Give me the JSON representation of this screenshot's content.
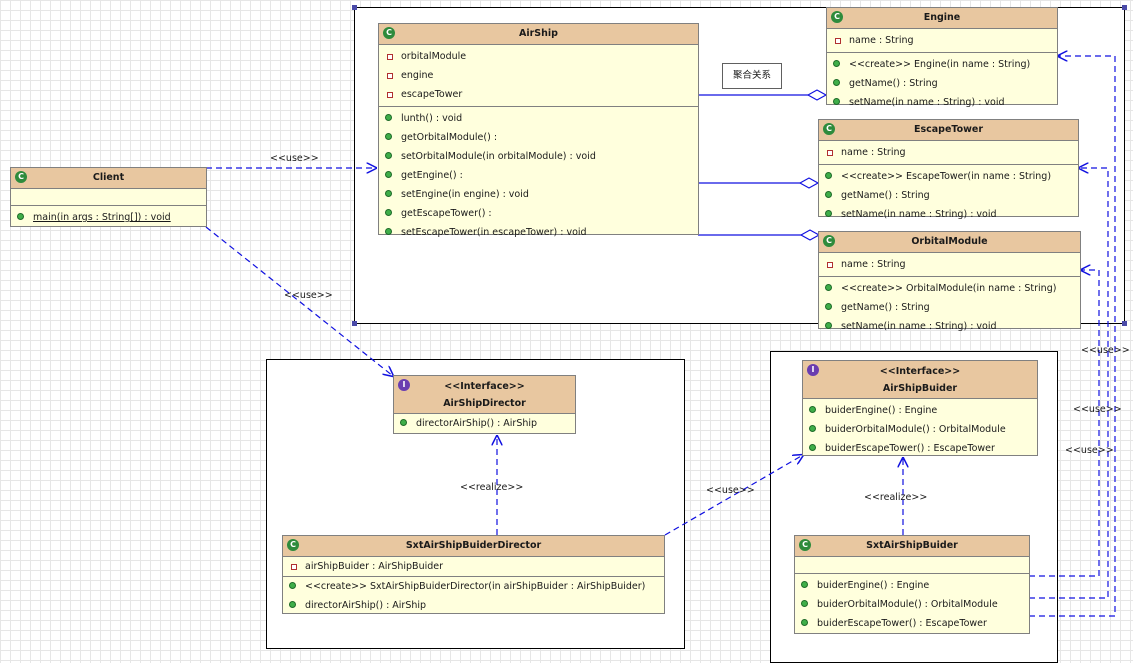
{
  "labels": {
    "use_client_airship": "<<use>>",
    "use_client_director": "<<use>>",
    "realize_director": "<<realize>>",
    "realize_builder": "<<realize>>",
    "use_director_builder": "<<use>>",
    "use_right_1": "<<use>>",
    "use_right_2": "<<use>>",
    "use_right_3": "<<use>>"
  },
  "note": {
    "text": "聚合关系"
  },
  "classes": {
    "client": {
      "name": "Client",
      "operations": [
        "main(in args : String[]) : void"
      ]
    },
    "airship": {
      "name": "AirShip",
      "attributes": [
        "orbitalModule",
        "engine",
        "escapeTower"
      ],
      "operations": [
        "lunth() : void",
        "getOrbitalModule() :",
        "setOrbitalModule(in orbitalModule) : void",
        "getEngine() :",
        "setEngine(in engine) : void",
        "getEscapeTower() :",
        "setEscapeTower(in escapeTower) : void"
      ]
    },
    "engine": {
      "name": "Engine",
      "attributes": [
        "name : String"
      ],
      "operations": [
        "<<create>> Engine(in name : String)",
        "getName() : String",
        "setName(in name : String) : void"
      ]
    },
    "escape_tower": {
      "name": "EscapeTower",
      "attributes": [
        "name : String"
      ],
      "operations": [
        "<<create>> EscapeTower(in name : String)",
        "getName() : String",
        "setName(in name : String) : void"
      ]
    },
    "orbital_module": {
      "name": "OrbitalModule",
      "attributes": [
        "name : String"
      ],
      "operations": [
        "<<create>> OrbitalModule(in name : String)",
        "getName() : String",
        "setName(in name : String) : void"
      ]
    },
    "airship_director": {
      "stereotype": "<<Interface>>",
      "name": "AirShipDirector",
      "operations": [
        "directorAirShip() : AirShip"
      ]
    },
    "airship_builder": {
      "stereotype": "<<Interface>>",
      "name": "AirShipBuider",
      "operations": [
        "buiderEngine() : Engine",
        "buiderOrbitalModule() : OrbitalModule",
        "buiderEscapeTower() : EscapeTower"
      ]
    },
    "sxt_director": {
      "name": "SxtAirShipBuiderDirector",
      "attributes": [
        "airShipBuider : AirShipBuider"
      ],
      "operations": [
        "<<create>> SxtAirShipBuiderDirector(in airShipBuider : AirShipBuider)",
        "directorAirShip() : AirShip"
      ]
    },
    "sxt_builder": {
      "name": "SxtAirShipBuider",
      "operations": [
        "buiderEngine() : Engine",
        "buiderOrbitalModule() : OrbitalModule",
        "buiderEscapeTower() : EscapeTower"
      ]
    }
  },
  "colors": {
    "class_fill": "#ffffdd",
    "class_header": "#e8c7a0",
    "link": "#1010e0",
    "class_icon": "#2e8b3c",
    "interface_icon": "#6a3db0"
  },
  "icons": {
    "class": "class-icon",
    "interface": "interface-icon",
    "attribute": "private-attribute-icon",
    "operation": "public-operation-icon"
  }
}
